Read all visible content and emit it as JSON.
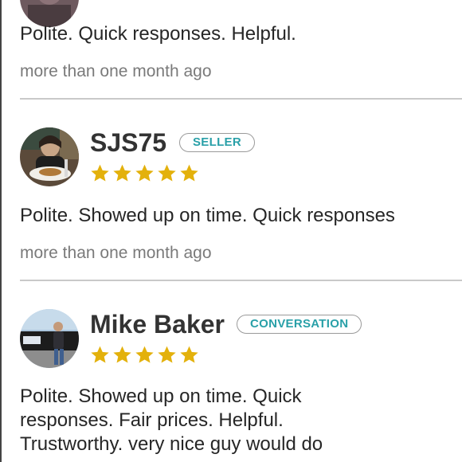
{
  "colors": {
    "star": "#e3b10c",
    "badge_text": "#29a0a8",
    "timestamp": "#7a7a7a",
    "divider": "#c9c9c9"
  },
  "reviews": [
    {
      "text": "Polite. Quick responses. Helpful.",
      "timestamp": "more than one month ago"
    },
    {
      "name": "SJS75",
      "badge": "SELLER",
      "rating": 5,
      "text": "Polite. Showed up on time. Quick responses",
      "timestamp": "more than one month ago"
    },
    {
      "name": "Mike Baker",
      "badge": "CONVERSATION",
      "rating": 5,
      "text": "Polite. Showed up on time. Quick responses. Fair prices. Helpful. Trustworthy. very nice guy would do"
    }
  ]
}
